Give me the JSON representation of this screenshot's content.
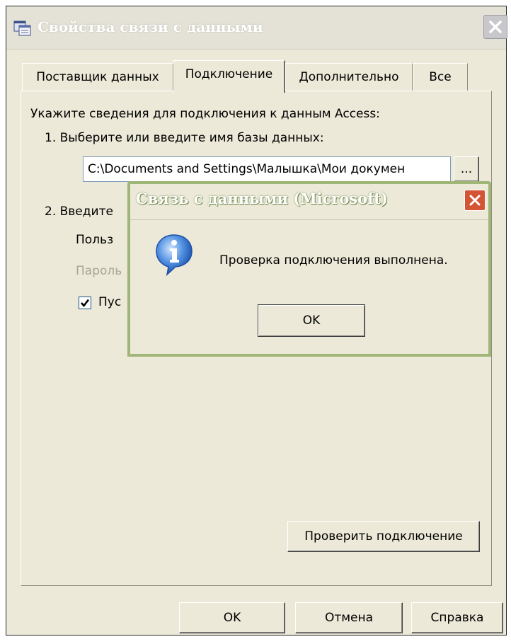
{
  "window": {
    "title": "Свойства связи с данными",
    "tabs": [
      "Поставщик данных",
      "Подключение",
      "Дополнительно",
      "Все"
    ],
    "active_tab": "Подключение"
  },
  "connection": {
    "intro": "Укажите сведения для подключения к данным Access:",
    "step1_label": "1. Выберите или введите имя базы данных:",
    "db_path": "C:\\Documents and Settings\\Малышка\\Мои докумен",
    "browse_label": "...",
    "step2_label": "2. Введите",
    "user_label": "Польз",
    "password_label": "Пароль",
    "blank_password_label": "Пус",
    "blank_password_checked": true,
    "test_button": "Проверить подключение"
  },
  "footer": {
    "ok": "OK",
    "cancel": "Отмена",
    "help": "Справка"
  },
  "modal": {
    "title": "Связь с данными (Microsoft)",
    "message": "Проверка подключения выполнена.",
    "ok": "OK",
    "icon": "info-icon"
  },
  "colors": {
    "window_bg": "#ece9d8",
    "modal_border": "#9fb676",
    "close_red": "#d45536"
  }
}
